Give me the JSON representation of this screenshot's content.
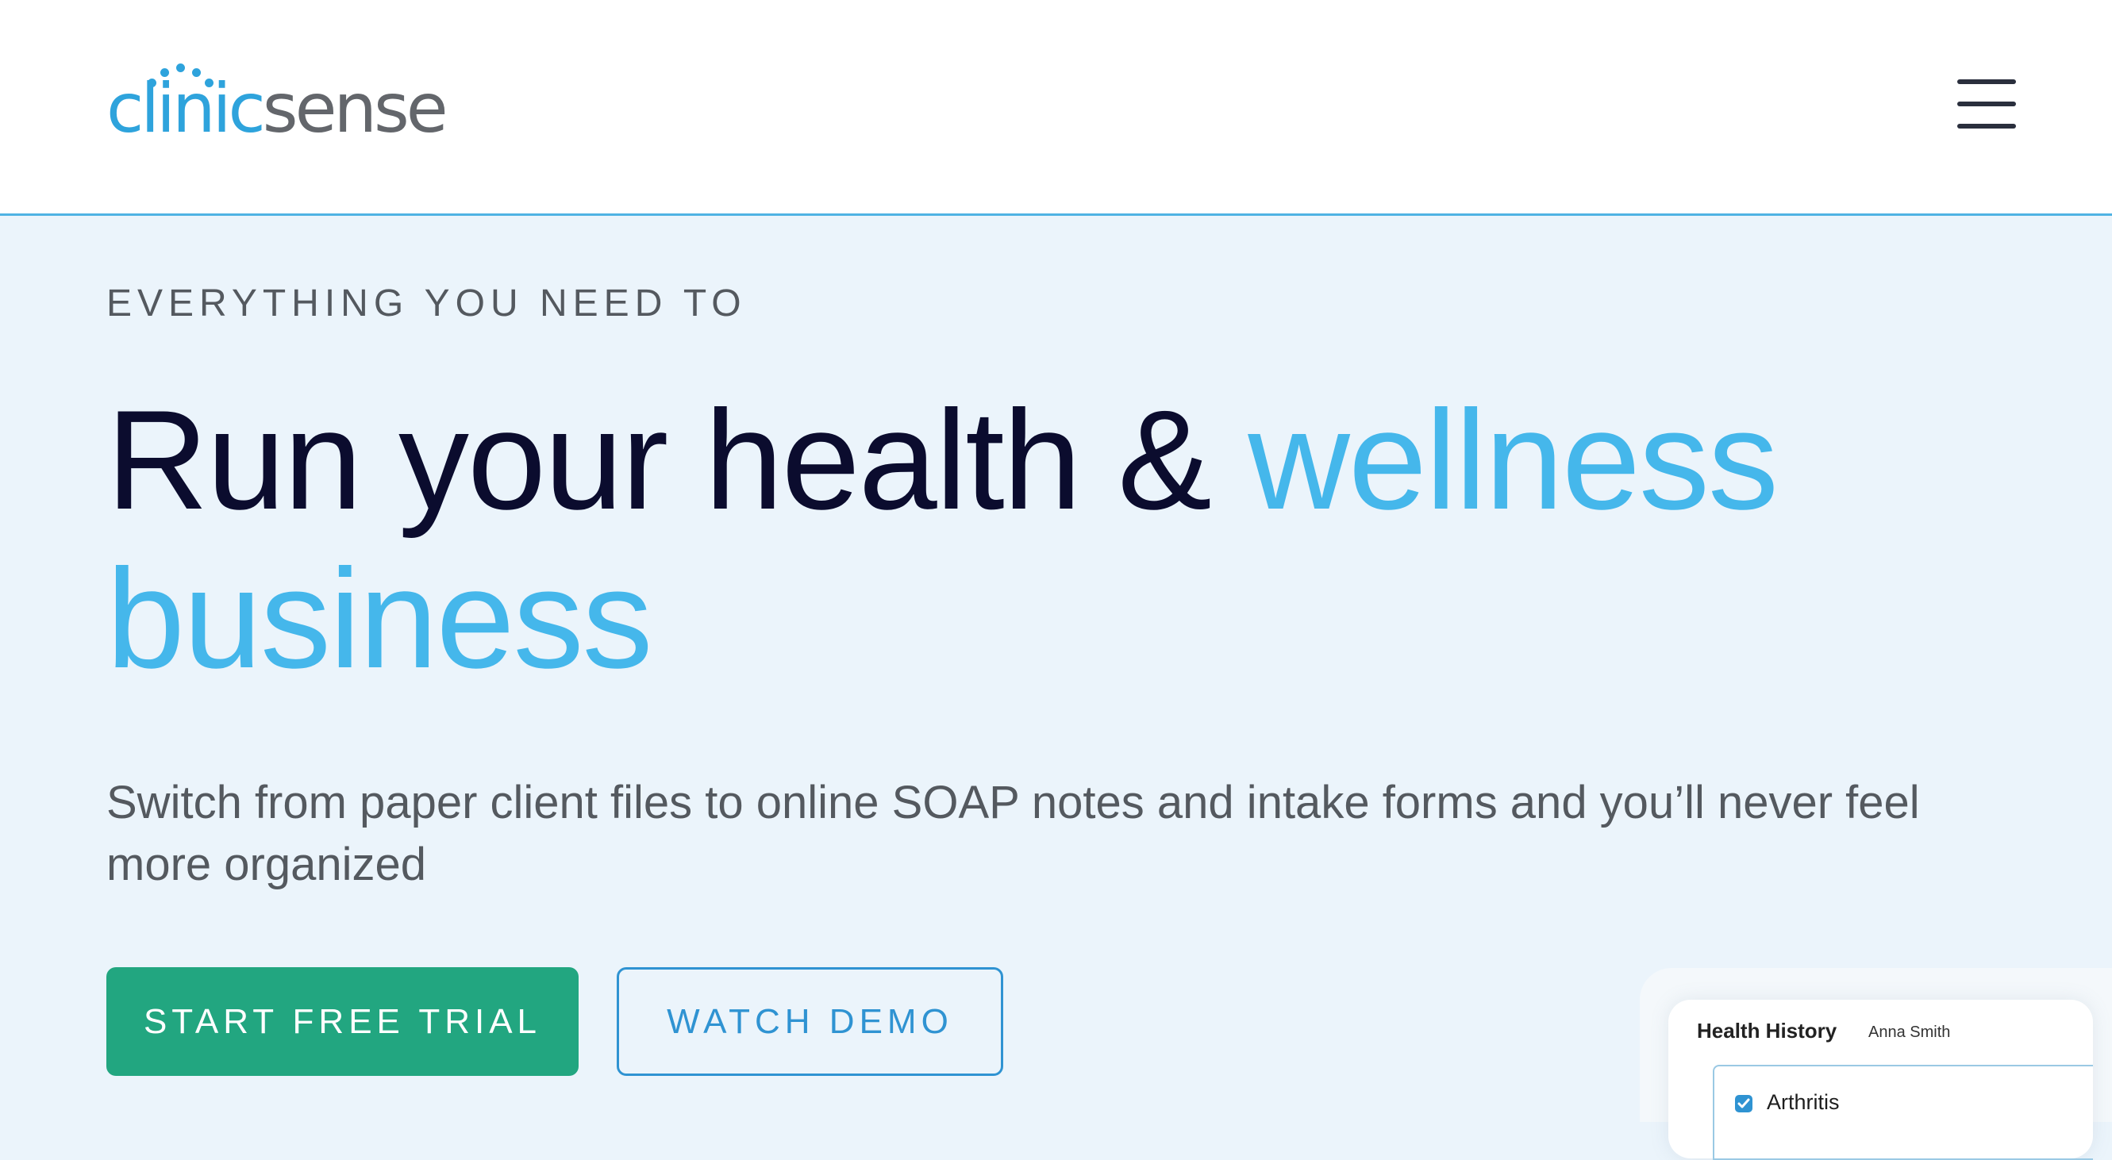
{
  "header": {
    "logo": {
      "part1": "clinic",
      "part2": "sense"
    },
    "menu_icon": "hamburger-menu-icon"
  },
  "hero": {
    "eyebrow": "EVERYTHING YOU NEED TO",
    "headline_dark": "Run your health & ",
    "headline_accent_1": "wellness",
    "headline_accent_2": "business",
    "subtext": "Switch from paper client files to online SOAP notes and intake forms and you’ll never feel more organized",
    "primary_cta": "START FREE TRIAL",
    "secondary_cta": "WATCH DEMO"
  },
  "form_preview": {
    "title": "Health History",
    "client_name": "Anna Smith",
    "checkbox_label": "Arthritis",
    "checkbox_checked": true
  },
  "colors": {
    "brand_blue": "#2ea3dc",
    "accent_blue": "#45b7eb",
    "cta_green": "#22a680",
    "hero_background": "#ebf4fb",
    "headline_dark": "#0b0c2e"
  }
}
